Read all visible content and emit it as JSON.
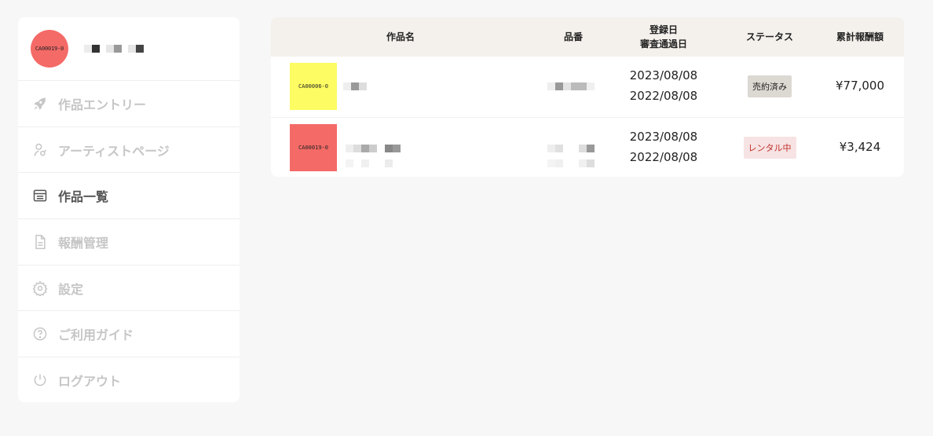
{
  "profile": {
    "avatar_text": "CA00019-0",
    "avatar_color": "#f46a67"
  },
  "nav": [
    {
      "label": "作品エントリー",
      "icon": "rocket-icon",
      "active": false
    },
    {
      "label": "アーティストページ",
      "icon": "artist-icon",
      "active": false
    },
    {
      "label": "作品一覧",
      "icon": "list-icon",
      "active": true
    },
    {
      "label": "報酬管理",
      "icon": "document-icon",
      "active": false
    },
    {
      "label": "設定",
      "icon": "gear-icon",
      "active": false
    },
    {
      "label": "ご利用ガイド",
      "icon": "help-icon",
      "active": false
    },
    {
      "label": "ログアウト",
      "icon": "power-icon",
      "active": false
    }
  ],
  "table": {
    "headers": {
      "title": "作品名",
      "number": "品番",
      "date_line1": "登録日",
      "date_line2": "審査通過日",
      "status": "ステータス",
      "amount": "累計報酬額"
    },
    "rows": [
      {
        "thumb_text": "CA00006-0",
        "thumb_color": "#fdfc62",
        "registered": "2023/08/08",
        "approved": "2022/08/08",
        "status": "売約済み",
        "status_type": "sold",
        "amount": "¥77,000"
      },
      {
        "thumb_text": "CA00019-0",
        "thumb_color": "#f46a67",
        "registered": "2023/08/08",
        "approved": "2022/08/08",
        "status": "レンタル中",
        "status_type": "rental",
        "amount": "¥3,424"
      }
    ]
  }
}
